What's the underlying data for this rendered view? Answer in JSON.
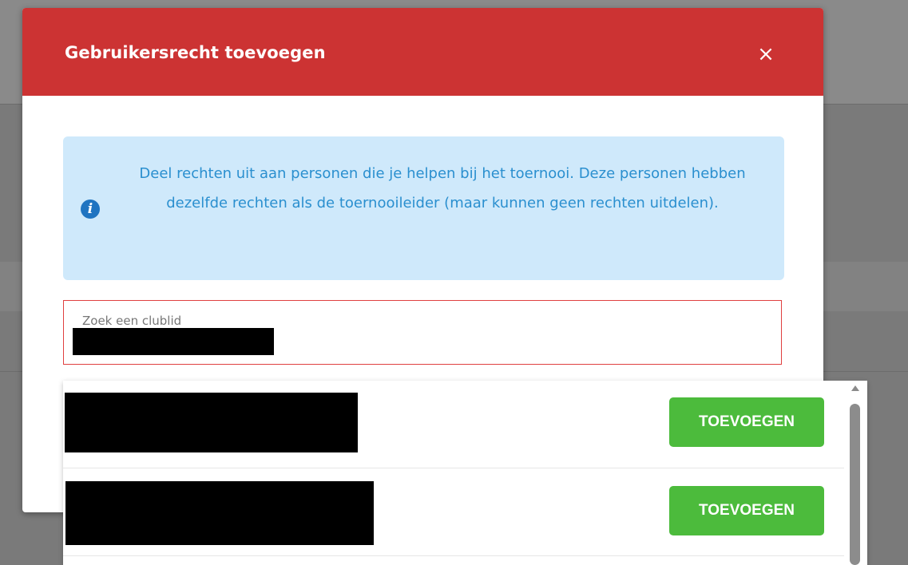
{
  "modal": {
    "title": "Gebruikersrecht toevoegen",
    "close_label": "×"
  },
  "info": {
    "icon": "info-icon",
    "icon_glyph": "i",
    "text": "Deel rechten uit aan personen die je helpen bij het toernooi. Deze personen hebben dezelfde rechten als de toernooileider (maar kunnen geen rechten uitdelen)."
  },
  "search": {
    "label": "Zoek een clublid",
    "value": "[redacted]"
  },
  "results": [
    {
      "name": "[redacted]",
      "add_label": "TOEVOEGEN"
    },
    {
      "name": "[redacted]",
      "add_label": "TOEVOEGEN"
    }
  ],
  "colors": {
    "header": "#cc3333",
    "info_bg": "#cfe9fb",
    "info_text": "#2a8fcf",
    "info_icon": "#1f74c1",
    "add_button": "#4cbb3c",
    "field_border": "#e04040"
  }
}
